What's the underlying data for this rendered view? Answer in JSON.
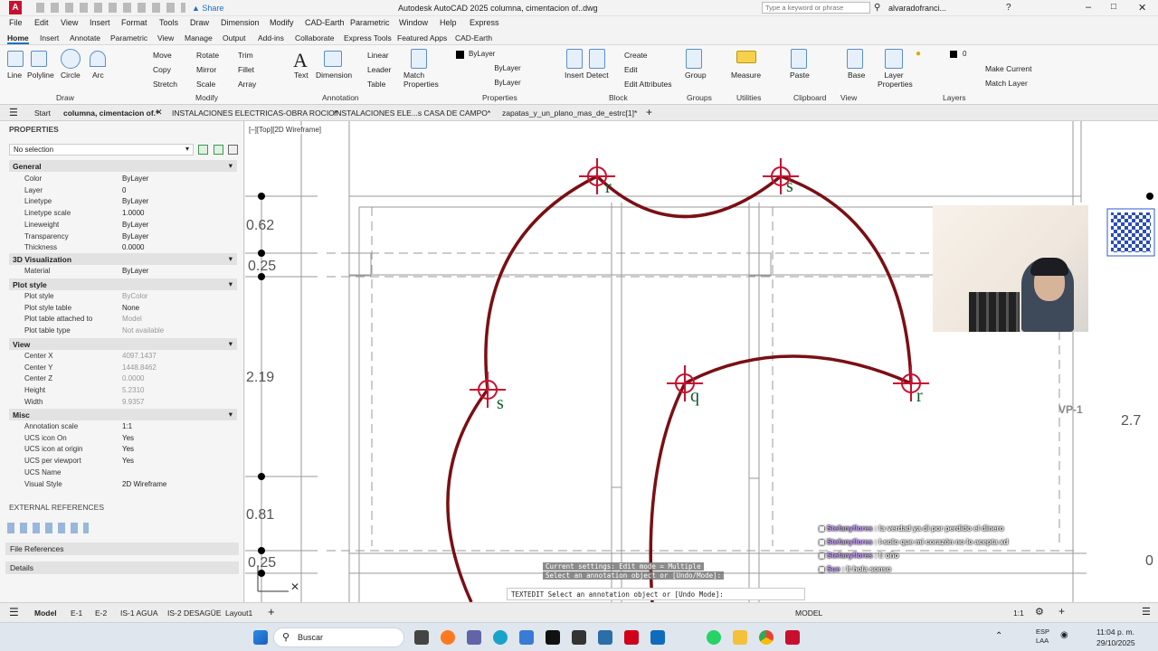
{
  "title_bar": {
    "share_label": "Share",
    "title": "Autodesk AutoCAD 2025   columna, cimentacion of..dwg",
    "search_placeholder": "Type a keyword or phrase",
    "user": "alvaradofranci..."
  },
  "menu": [
    "File",
    "Edit",
    "View",
    "Insert",
    "Format",
    "Tools",
    "Draw",
    "Dimension",
    "Modify",
    "CAD-Earth",
    "Parametric",
    "Window",
    "Help",
    "Express"
  ],
  "ribbon_tabs": [
    "Home",
    "Insert",
    "Annotate",
    "Parametric",
    "View",
    "Manage",
    "Output",
    "Add-ins",
    "Collaborate",
    "Express Tools",
    "Featured Apps",
    "CAD-Earth"
  ],
  "ribbon": {
    "draw": {
      "line": "Line",
      "polyline": "Polyline",
      "circle": "Circle",
      "arc": "Arc",
      "group": "Draw"
    },
    "modify": {
      "move": "Move",
      "rotate": "Rotate",
      "trim": "Trim",
      "copy": "Copy",
      "mirror": "Mirror",
      "fillet": "Fillet",
      "stretch": "Stretch",
      "scale": "Scale",
      "array": "Array",
      "group": "Modify"
    },
    "annotation": {
      "text": "Text",
      "dimension": "Dimension",
      "linear": "Linear",
      "leader": "Leader",
      "table": "Table",
      "group": "Annotation"
    },
    "properties": {
      "match": "Match Properties",
      "layer": "ByLayer",
      "linetype": "ByLayer",
      "lineweight": "ByLayer",
      "group": "Properties"
    },
    "block": {
      "insert": "Insert",
      "detect": "Detect",
      "create": "Create",
      "edit": "Edit",
      "edit_attributes": "Edit Attributes",
      "group": "Block"
    },
    "groups": {
      "group": "Group",
      "label": "Groups"
    },
    "utilities": {
      "measure": "Measure",
      "label": "Utilities"
    },
    "clipboard": {
      "paste": "Paste",
      "label": "Clipboard"
    },
    "view": {
      "base": "Base",
      "label": "View"
    },
    "layers": {
      "layer_properties": "Layer Properties",
      "current": "0",
      "make_current": "Make Current",
      "match_layer": "Match Layer",
      "label": "Layers"
    }
  },
  "doc_tabs": [
    "Start",
    "columna, cimentacion of.*",
    "INSTALACIONES ELECTRICAS-OBRA ROCIO*",
    "INSTALACIONES ELE...s CASA DE CAMPO*",
    "zapatas_y_un_plano_mas_de_estrc[1]*"
  ],
  "properties": {
    "header": "PROPERTIES",
    "selection": "No selection",
    "sections": {
      "general": "General",
      "visualization": "3D Visualization",
      "plot": "Plot style",
      "view": "View",
      "misc": "Misc"
    },
    "general": [
      {
        "k": "Color",
        "v": "ByLayer"
      },
      {
        "k": "Layer",
        "v": "0"
      },
      {
        "k": "Linetype",
        "v": "ByLayer"
      },
      {
        "k": "Linetype scale",
        "v": "1.0000"
      },
      {
        "k": "Lineweight",
        "v": "ByLayer"
      },
      {
        "k": "Transparency",
        "v": "ByLayer"
      },
      {
        "k": "Thickness",
        "v": "0.0000"
      }
    ],
    "visualization": [
      {
        "k": "Material",
        "v": "ByLayer"
      }
    ],
    "plot": [
      {
        "k": "Plot style",
        "v": "ByColor"
      },
      {
        "k": "Plot style table",
        "v": "None"
      },
      {
        "k": "Plot table attached to",
        "v": "Model"
      },
      {
        "k": "Plot table type",
        "v": "Not available"
      }
    ],
    "view": [
      {
        "k": "Center X",
        "v": "4097.1437"
      },
      {
        "k": "Center Y",
        "v": "1448.8462"
      },
      {
        "k": "Center Z",
        "v": "0.0000"
      },
      {
        "k": "Height",
        "v": "5.2310"
      },
      {
        "k": "Width",
        "v": "9.9357"
      }
    ],
    "misc": [
      {
        "k": "Annotation scale",
        "v": "1:1"
      },
      {
        "k": "UCS icon On",
        "v": "Yes"
      },
      {
        "k": "UCS icon at origin",
        "v": "Yes"
      },
      {
        "k": "UCS per viewport",
        "v": "Yes"
      },
      {
        "k": "UCS Name",
        "v": ""
      },
      {
        "k": "Visual Style",
        "v": "2D Wireframe"
      }
    ]
  },
  "external_refs": {
    "header": "EXTERNAL REFERENCES",
    "file_refs": "File References",
    "details": "Details"
  },
  "viewport": {
    "label": "[–][Top][2D Wireframe]",
    "dims": [
      "0.62",
      "0.25",
      "2.19",
      "0.81",
      "0.25",
      "2.7"
    ],
    "labels": [
      "r",
      "s",
      "s",
      "q",
      "r",
      "VP-1",
      "0"
    ]
  },
  "command": {
    "line1": "Current settings: Edit mode = Multiple",
    "line2": "Select an annotation object or [Undo/Mode]:",
    "prompt": "TEXTEDIT Select an annotation object or [Undo Mode]:"
  },
  "chat": [
    {
      "user": "Stefanyflores",
      "msg": "la verdad ya di por perdido el dinero"
    },
    {
      "user": "Stefanyflores",
      "msg": "I-solo que mi corazón no lo acepta xd"
    },
    {
      "user": "Stefanyflores",
      "msg": "I: oño"
    },
    {
      "user": "Sue",
      "msg": "It hola sonso"
    }
  ],
  "layout_tabs": [
    "Model",
    "E-1",
    "E-2",
    "IS-1 AGUA",
    "IS-2 DESAGÜE",
    "Layout1"
  ],
  "status": {
    "model": "MODEL",
    "scale": "1:1"
  },
  "taskbar": {
    "search": "Buscar",
    "lang": "ESP\nLAA",
    "time": "11:04 p. m.",
    "date": "29/10/2025"
  },
  "colors": {
    "arc": "#7a0f14",
    "marker": "#c8102e",
    "accent": "#c8102e"
  }
}
